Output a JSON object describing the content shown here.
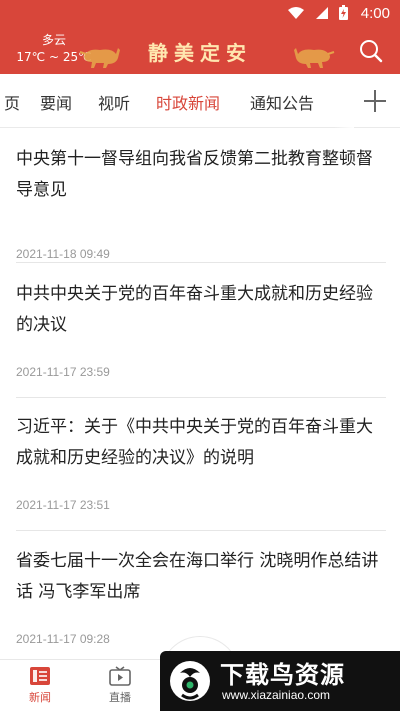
{
  "status_bar": {
    "time": "4:00"
  },
  "header": {
    "weather_condition": "多云",
    "weather_temp": "17℃ ~ 25℃",
    "brand_title": "静美定安"
  },
  "tabs": [
    {
      "label": "页"
    },
    {
      "label": "要闻"
    },
    {
      "label": "视听"
    },
    {
      "label": "时政新闻",
      "active": true
    },
    {
      "label": "通知公告"
    }
  ],
  "news": [
    {
      "title": "中央第十一督导组向我省反馈第二批教育整顿督导意见",
      "date": "2021-11-18 09:49"
    },
    {
      "title": "中共中央关于党的百年奋斗重大成就和历史经验的决议",
      "date": "2021-11-17 23:59"
    },
    {
      "title": "习近平：关于《中共中央关于党的百年奋斗重大成就和历史经验的决议》的说明",
      "date": "2021-11-17 23:51"
    },
    {
      "title": "省委七届十一次全会在海口举行 沈晓明作总结讲话 冯飞李军出席",
      "date": "2021-11-17 09:28"
    }
  ],
  "bottom_nav": [
    {
      "label": "新闻",
      "icon": "news-icon",
      "active": true
    },
    {
      "label": "直播",
      "icon": "tv-icon"
    }
  ],
  "watermark": {
    "text": "下载鸟资源",
    "url": "www.xiazainiao.com"
  },
  "colors": {
    "brand_red": "#d8463a",
    "brand_gold": "#ffe7b0",
    "date_gray": "#999999"
  }
}
